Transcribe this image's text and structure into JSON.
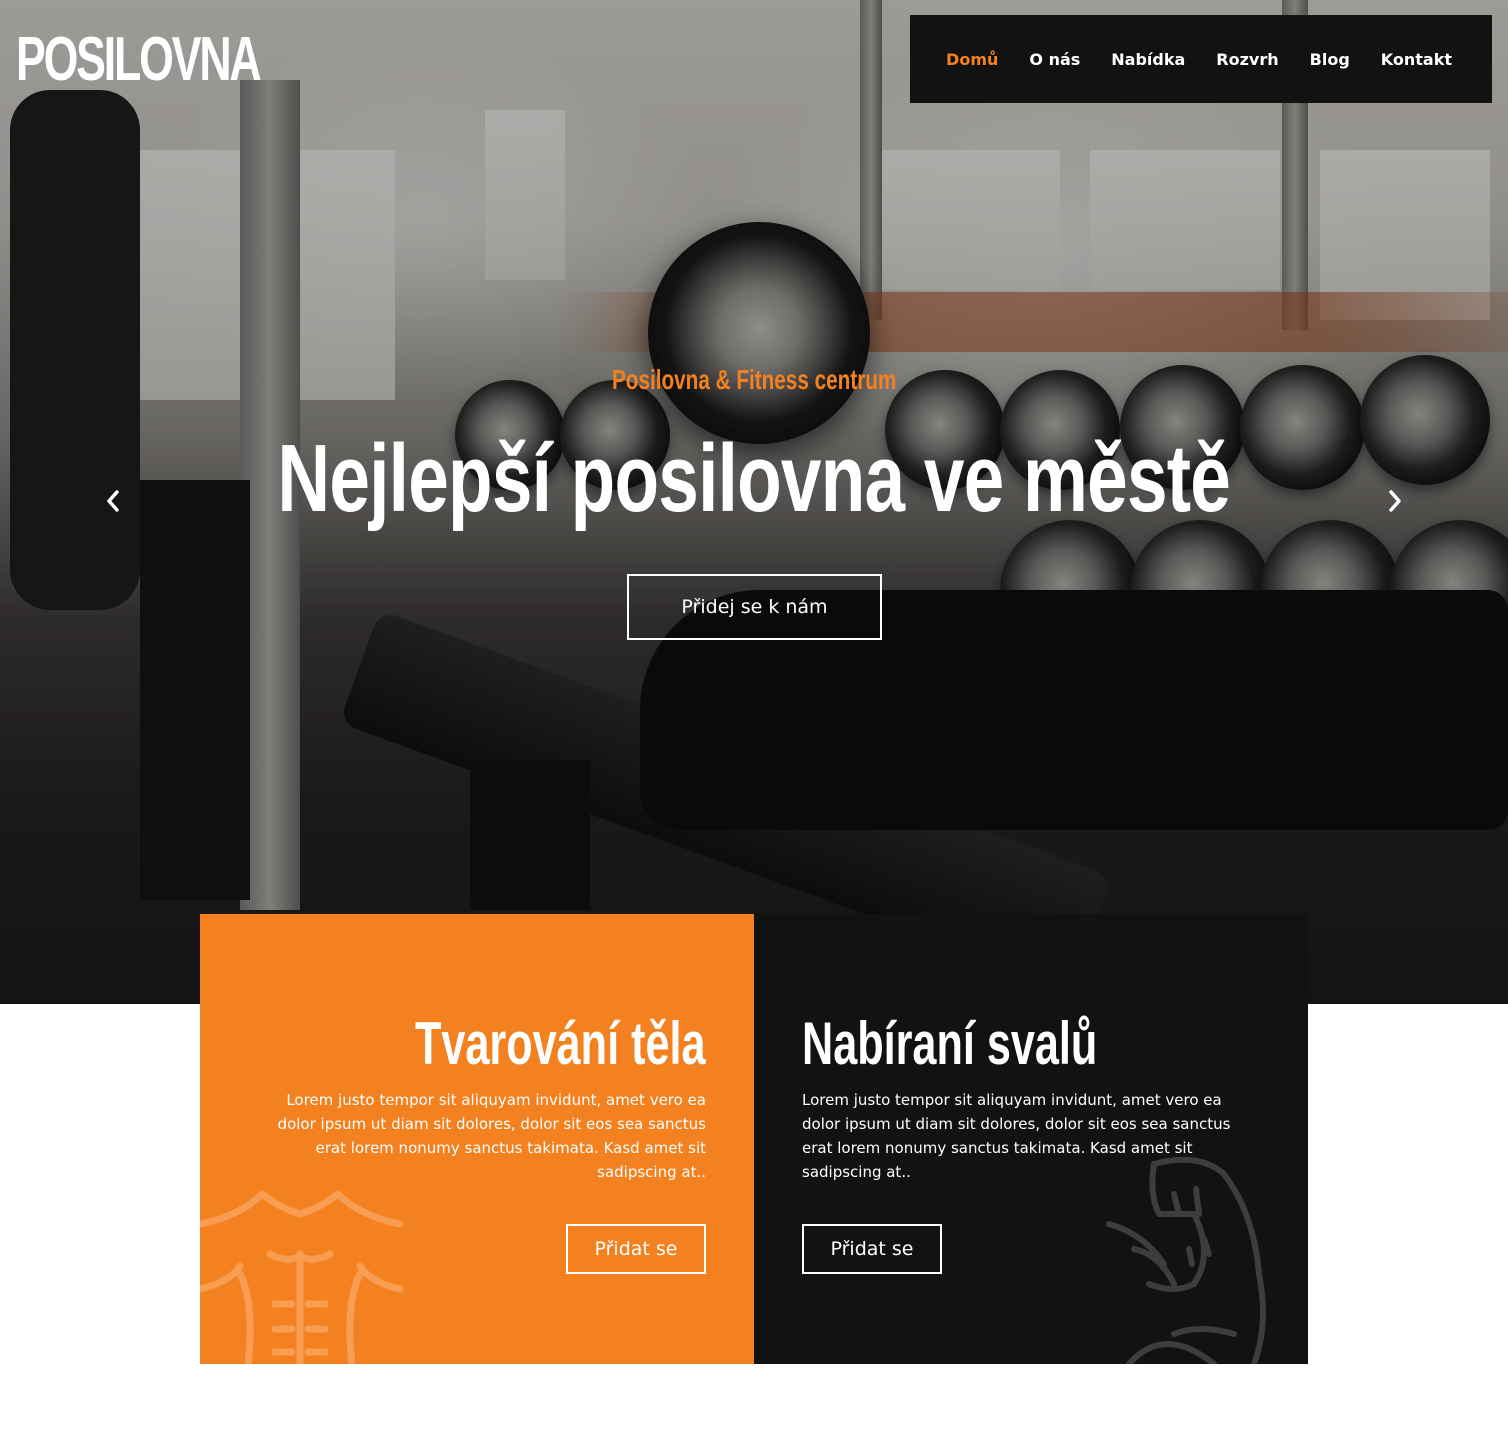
{
  "brand": {
    "logo": "POSILOVNA"
  },
  "nav": {
    "items": [
      {
        "label": "Domů",
        "active": true
      },
      {
        "label": "O nás"
      },
      {
        "label": "Nabídka"
      },
      {
        "label": "Rozvrh"
      },
      {
        "label": "Blog"
      },
      {
        "label": "Kontakt"
      }
    ]
  },
  "hero": {
    "subtitle": "Posilovna & Fitness centrum",
    "title": "Nejlepší posilovna ve městě",
    "button": "Přidej se k nám",
    "prev_icon": "chevron-left-icon",
    "next_icon": "chevron-right-icon"
  },
  "cards": [
    {
      "title": "Tvarování těla",
      "text": "Lorem justo tempor sit aliquyam invidunt, amet vero ea dolor ipsum ut diam sit dolores, dolor sit eos sea sanctus erat lorem nonumy sanctus takimata. Kasd amet sit sadipscing at..",
      "button": "Přidat se",
      "icon": "torso-icon",
      "background": "#f4811f"
    },
    {
      "title": "Nabíraní svalů",
      "text": "Lorem justo tempor sit aliquyam invidunt, amet vero ea dolor ipsum ut diam sit dolores, dolor sit eos sea sanctus erat lorem nonumy sanctus takimata. Kasd amet sit sadipscing at..",
      "button": "Přidat se",
      "icon": "biceps-arm-icon",
      "background": "#121212"
    }
  ],
  "colors": {
    "accent": "#f4811f",
    "dark": "#121212",
    "text_light": "#ffffff"
  }
}
